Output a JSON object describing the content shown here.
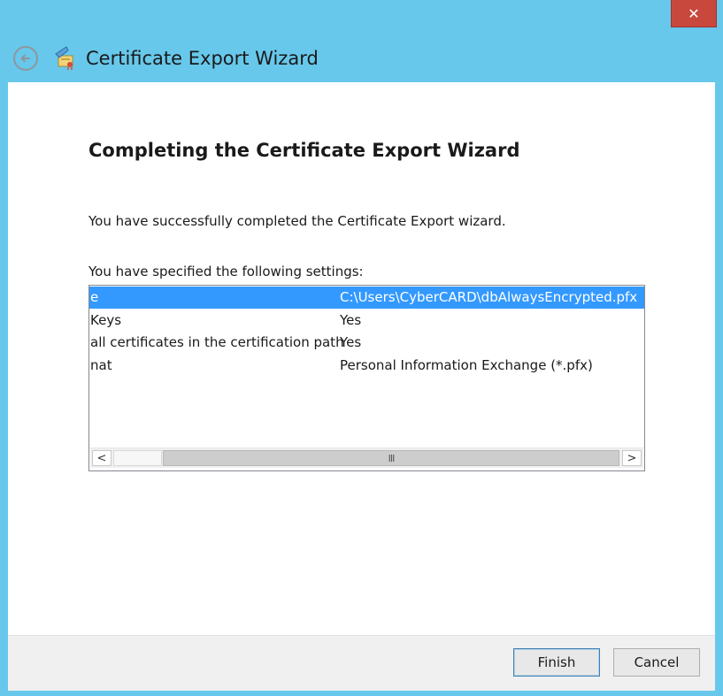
{
  "window": {
    "title": "Certificate Export Wizard",
    "close_glyph": "✕"
  },
  "page": {
    "heading": "Completing the Certificate Export Wizard",
    "success_text": "You have successfully completed the Certificate Export wizard.",
    "settings_label": "You have specified the following settings:"
  },
  "settings": [
    {
      "name": "e",
      "value": "C:\\Users\\CyberCARD\\dbAlwaysEncrypted.pfx",
      "selected": true
    },
    {
      "name": "Keys",
      "value": "Yes",
      "selected": false
    },
    {
      "name": "all certificates in the certification path",
      "value": "Yes",
      "selected": false
    },
    {
      "name": "nat",
      "value": "Personal Information Exchange (*.pfx)",
      "selected": false
    }
  ],
  "scrollbar": {
    "left_glyph": "<",
    "right_glyph": ">",
    "thumb_grip": "III"
  },
  "buttons": {
    "finish": "Finish",
    "cancel": "Cancel"
  },
  "icons": {
    "back": "back-arrow-icon",
    "wizard": "certificate-wizard-icon",
    "close": "close-icon"
  },
  "colors": {
    "frame": "#67c8eb",
    "selection": "#3399ff",
    "close": "#c9483e"
  }
}
